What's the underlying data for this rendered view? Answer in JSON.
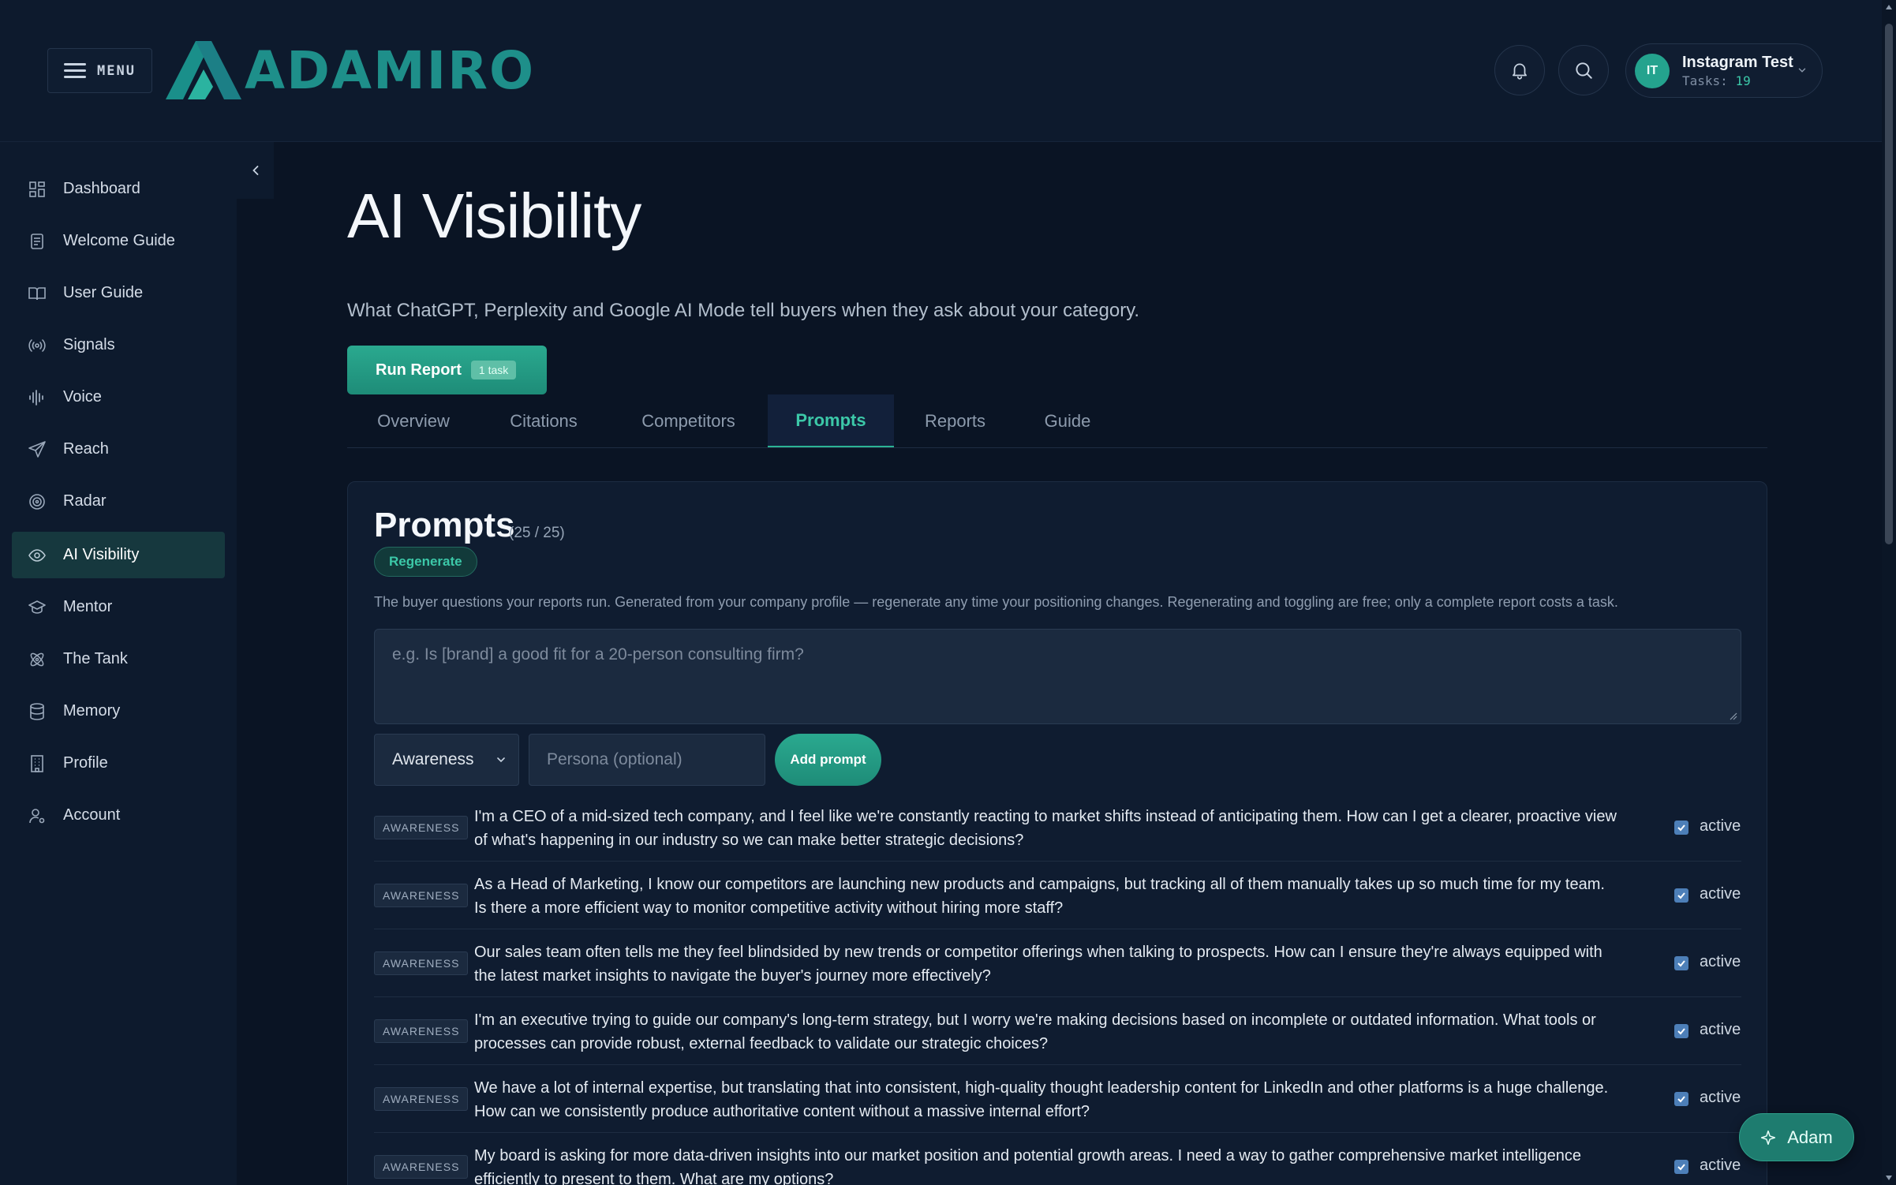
{
  "header": {
    "menu_label": "MENU",
    "logo_text": "ADAMIRO",
    "user": {
      "initials": "IT",
      "name": "Instagram Test",
      "tasks_label": "Tasks:",
      "tasks_count": "19"
    }
  },
  "sidebar": {
    "items": [
      {
        "label": "Dashboard",
        "icon": "dashboard-icon"
      },
      {
        "label": "Welcome Guide",
        "icon": "document-icon"
      },
      {
        "label": "User Guide",
        "icon": "book-icon"
      },
      {
        "label": "Signals",
        "icon": "broadcast-icon"
      },
      {
        "label": "Voice",
        "icon": "waveform-icon"
      },
      {
        "label": "Reach",
        "icon": "send-icon"
      },
      {
        "label": "Radar",
        "icon": "radar-icon"
      },
      {
        "label": "AI Visibility",
        "icon": "eye-icon",
        "active": true
      },
      {
        "label": "Mentor",
        "icon": "graduation-cap-icon"
      },
      {
        "label": "The Tank",
        "icon": "atom-icon"
      },
      {
        "label": "Memory",
        "icon": "database-icon"
      },
      {
        "label": "Profile",
        "icon": "building-icon"
      },
      {
        "label": "Account",
        "icon": "user-gear-icon"
      }
    ]
  },
  "main": {
    "title": "AI Visibility",
    "subtitle": "What ChatGPT, Perplexity and Google AI Mode tell buyers when they ask about your category.",
    "run_button": {
      "label": "Run Report",
      "badge": "1 task"
    },
    "tabs": [
      {
        "label": "Overview"
      },
      {
        "label": "Citations"
      },
      {
        "label": "Competitors"
      },
      {
        "label": "Prompts",
        "active": true
      },
      {
        "label": "Reports"
      },
      {
        "label": "Guide"
      }
    ]
  },
  "prompts_card": {
    "title": "Prompts",
    "count": "(25 / 25)",
    "regenerate_label": "Regenerate",
    "description": "The buyer questions your reports run. Generated from your company profile — regenerate any time your positioning changes. Regenerating and toggling are free; only a complete report costs a task.",
    "input_placeholder": "e.g. Is [brand] a good fit for a 20-person consulting firm?",
    "stage_select": "Awareness",
    "persona_placeholder": "Persona (optional)",
    "add_label": "Add prompt",
    "rows": [
      {
        "stage": "AWARENESS",
        "text": "I'm a CEO of a mid-sized tech company, and I feel like we're constantly reacting to market shifts instead of anticipating them. How can I get a clearer, proactive view of what's happening in our industry so we can make better strategic decisions?",
        "status": "active"
      },
      {
        "stage": "AWARENESS",
        "text": "As a Head of Marketing, I know our competitors are launching new products and campaigns, but tracking all of them manually takes up so much time for my team. Is there a more efficient way to monitor competitive activity without hiring more staff?",
        "status": "active"
      },
      {
        "stage": "AWARENESS",
        "text": "Our sales team often tells me they feel blindsided by new trends or competitor offerings when talking to prospects. How can I ensure they're always equipped with the latest market insights to navigate the buyer's journey more effectively?",
        "status": "active"
      },
      {
        "stage": "AWARENESS",
        "text": "I'm an executive trying to guide our company's long-term strategy, but I worry we're making decisions based on incomplete or outdated information. What tools or processes can provide robust, external feedback to validate our strategic choices?",
        "status": "active"
      },
      {
        "stage": "AWARENESS",
        "text": "We have a lot of internal expertise, but translating that into consistent, high-quality thought leadership content for LinkedIn and other platforms is a huge challenge. How can we consistently produce authoritative content without a massive internal effort?",
        "status": "active"
      },
      {
        "stage": "AWARENESS",
        "text": "My board is asking for more data-driven insights into our market position and potential growth areas. I need a way to gather comprehensive market intelligence efficiently to present to them. What are my options?",
        "status": "active"
      }
    ]
  },
  "assistant": {
    "label": "Adam"
  },
  "colors": {
    "accent": "#2bb394",
    "background": "#0a1424",
    "sidebar": "#0d1a2d",
    "active_nav": "#16383e"
  }
}
